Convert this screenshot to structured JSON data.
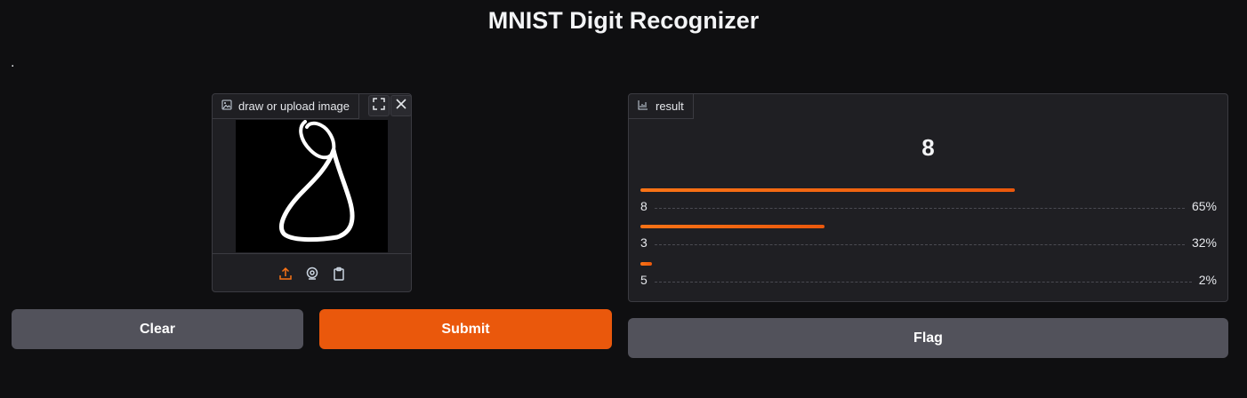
{
  "header": {
    "title": "MNIST Digit Recognizer",
    "description": "."
  },
  "image_input": {
    "label": "draw or upload image",
    "icons": [
      "image-icon",
      "fullscreen-icon",
      "close-icon",
      "upload-icon",
      "webcam-icon",
      "clipboard-icon"
    ]
  },
  "result": {
    "label": "result",
    "predicted": "8",
    "confidences": [
      {
        "label": "8",
        "percent": "65%",
        "value": 0.65
      },
      {
        "label": "3",
        "percent": "32%",
        "value": 0.32
      },
      {
        "label": "5",
        "percent": "2%",
        "value": 0.02
      }
    ]
  },
  "buttons": {
    "clear": "Clear",
    "submit": "Submit",
    "flag": "Flag"
  },
  "colors": {
    "accent": "#ea580c",
    "background": "#0f0f11",
    "panel": "#1f1f23",
    "secondary_button": "#52525b"
  }
}
